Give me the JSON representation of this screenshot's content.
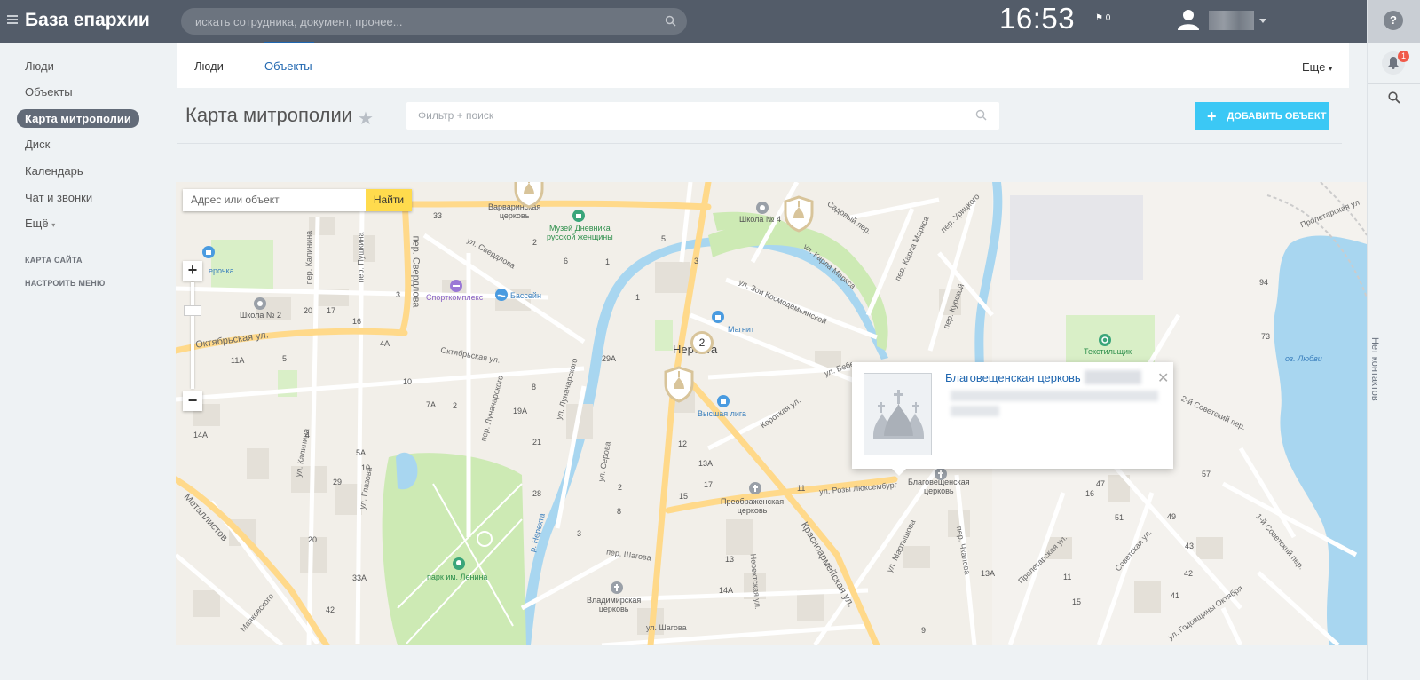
{
  "topbar": {
    "brand": "База епархии",
    "search_placeholder": "искать сотрудника, документ, прочее...",
    "clock": "16:53",
    "flag_count": "0"
  },
  "rail": {
    "help": "?",
    "notifications_badge": "1",
    "contacts_label": "Нет контактов"
  },
  "sidebar": {
    "items": [
      {
        "label": "Люди"
      },
      {
        "label": "Объекты"
      },
      {
        "label": "Карта митрополии"
      },
      {
        "label": "Диск"
      },
      {
        "label": "Календарь"
      },
      {
        "label": "Чат и звонки"
      },
      {
        "label": "Ещё"
      }
    ],
    "sitemap": "КАРТА САЙТА",
    "configure": "НАСТРОИТЬ МЕНЮ"
  },
  "tabs": {
    "items": [
      {
        "label": "Люди"
      },
      {
        "label": "Объекты"
      }
    ],
    "more": "Еще"
  },
  "page": {
    "title": "Карта митрополии",
    "filter_placeholder": "Фильтр + поиск",
    "add_button": "ДОБАВИТЬ ОБЪЕКТ"
  },
  "map": {
    "address_placeholder": "Адрес или объект",
    "find_button": "Найти",
    "cluster_count": "2",
    "popup_title": "Благовещенская церковь",
    "labels": {
      "varvarinskaya": "Варваринская\nцерковь",
      "museum": "Музей Дневника\nрусской женщины",
      "school4": "Школа № 4",
      "sadovy": "Садовый пер.",
      "urickogo": "пер. Урицкого",
      "karla_marksa_per": "пер. Карла Маркса",
      "karla_marksa_ul": "ул. Карла Маркса",
      "proletarskaya": "Пролетарская ул.",
      "pyatyorochka": "ерочка",
      "school2": "Школа № 2",
      "kalinina": "пер. Калинина",
      "pushkina": "пер. Пушкина",
      "sverdlova_per": "пер. Свердлова",
      "sverdlova_ul": "ул. Свердлова",
      "sport": "Спорткомплекс",
      "pool": "Бассейн",
      "zoi": "ул. Зои Космодемьянской",
      "kurskoy": "пер. Курской",
      "magnit": "Магнит",
      "nerekhta": "Нерехта",
      "oktyabrskaya_ul": "Октябрьская ул.",
      "oktyabrskaya_ul2": "Октябрьская ул.",
      "lunacharskogo_ul": "ул. Луначарского",
      "lunacharskogo_per": "пер. Луначарского",
      "tekstilshchik": "Текстильщик",
      "lake": "оз. Любви",
      "bebel": "ул. Бебе",
      "vysshaya_liga": "Высшая лига",
      "korotkaya": "Короткая ул.",
      "sovetskaya2": "2-й Советский пер.",
      "kalinina_ul": "ул. Калинина",
      "glazova": "ул. Глазова",
      "serova": "ул. Серова",
      "metallistov": "Металлистов",
      "nerekhta_river": "р. Нерехта",
      "park": "парк им. Ленина",
      "preobrazhenskaya": "Преображенская\nцерковь",
      "rozy": "ул. Розы Люксембург",
      "blagoveshchenskaya": "Благовещенская\nцерковь",
      "krasnoarmeyskaya": "Красноармейская ул.",
      "martyshova": "ул. Мартышова",
      "chkalova": "пер. Чкалова",
      "proletarskaya2": "Пролетарская ул.",
      "sovetskaya_ul": "Советская ул.",
      "sovetsky1": "1-й Советский пер.",
      "shagova_per": "пер. Шагова",
      "shagova_ul": "ул. Шагова",
      "nerekhtskaya": "Нерехтская ул.",
      "vladimirskaya": "Владимирская\nцерковь",
      "mayakovskogo": "Маяковского",
      "godovshchiny": "ул. Годовщины Октября"
    },
    "house_numbers": [
      "33",
      "2",
      "6",
      "1",
      "5",
      "3",
      "1",
      "3",
      "20",
      "17",
      "16",
      "4A",
      "11A",
      "5",
      "10",
      "7A",
      "2",
      "29A",
      "8",
      "19A",
      "21",
      "14A",
      "4",
      "5A",
      "10",
      "29",
      "12",
      "13A",
      "15",
      "17",
      "28",
      "3",
      "8",
      "2",
      "11",
      "13",
      "20",
      "33A",
      "42",
      "14A",
      "94",
      "73",
      "57",
      "16",
      "47",
      "51",
      "49",
      "43",
      "42",
      "41",
      "13A",
      "11",
      "15",
      "9"
    ],
    "colors": {
      "road": "#ffd98a",
      "river": "#a8d6f0",
      "park": "#cdeab4",
      "building": "#e4e0d8",
      "marker": "#d8c49a"
    }
  }
}
